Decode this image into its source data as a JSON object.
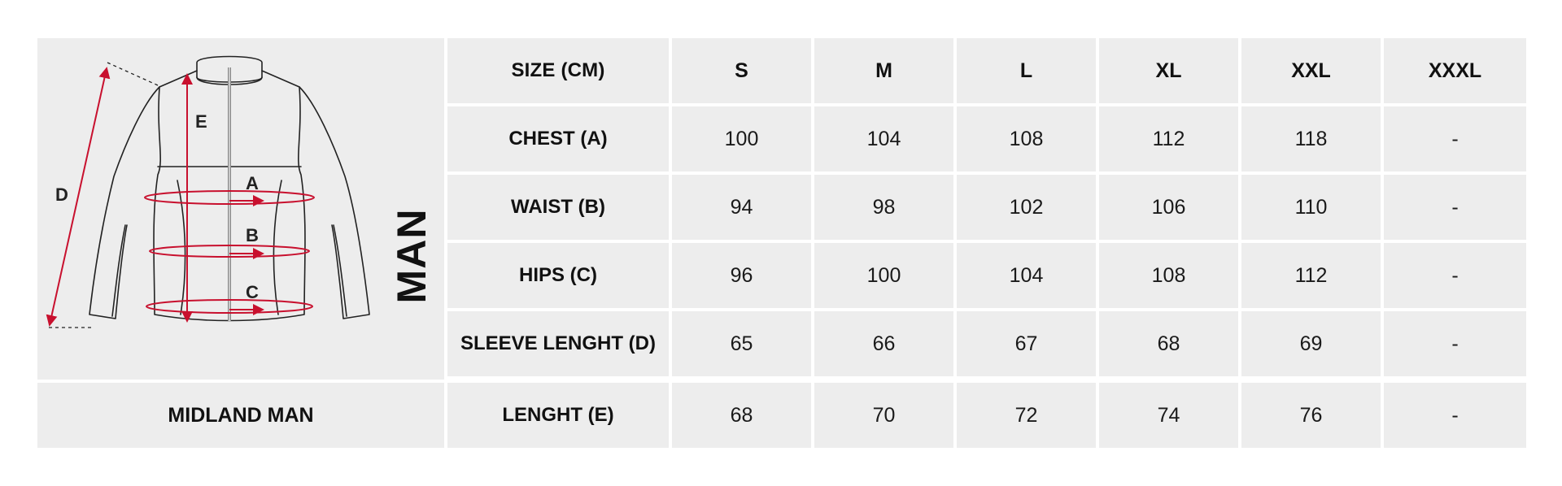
{
  "product_name": "MIDLAND MAN",
  "gender_label": "MAN",
  "diagram_labels": {
    "a": "A",
    "b": "B",
    "c": "C",
    "d": "D",
    "e": "E"
  },
  "accent_color": "#c8102e",
  "header": {
    "size_label": "SIZE (CM)",
    "sizes": [
      "S",
      "M",
      "L",
      "XL",
      "XXL",
      "XXXL"
    ]
  },
  "rows": [
    {
      "label": "CHEST (A)",
      "values": [
        "100",
        "104",
        "108",
        "112",
        "118",
        "-"
      ]
    },
    {
      "label": "WAIST (B)",
      "values": [
        "94",
        "98",
        "102",
        "106",
        "110",
        "-"
      ]
    },
    {
      "label": "HIPS (C)",
      "values": [
        "96",
        "100",
        "104",
        "108",
        "112",
        "-"
      ]
    },
    {
      "label": "SLEEVE LENGHT (D)",
      "values": [
        "65",
        "66",
        "67",
        "68",
        "69",
        "-"
      ]
    },
    {
      "label": "LENGHT (E)",
      "values": [
        "68",
        "70",
        "72",
        "74",
        "76",
        "-"
      ]
    }
  ]
}
